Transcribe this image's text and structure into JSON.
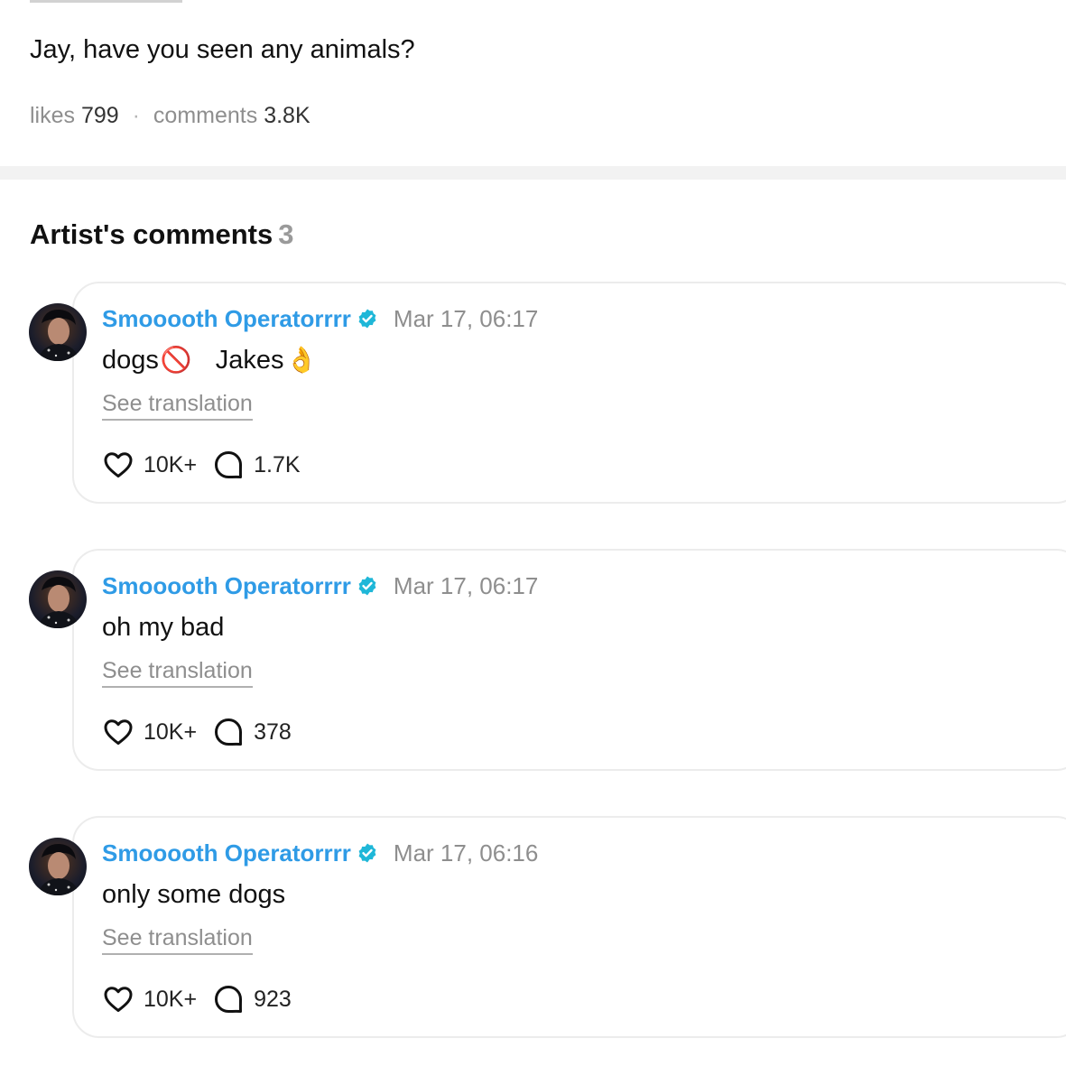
{
  "post": {
    "text": "Jay, have you seen any animals?",
    "likes_label": "likes",
    "likes_count": "799",
    "separator": "·",
    "comments_label": "comments",
    "comments_count": "3.8K"
  },
  "section": {
    "title": "Artist's comments",
    "count": "3"
  },
  "comments": [
    {
      "author": "Smooooth Operatorrrr",
      "time": "Mar 17, 06:17",
      "text_a": "dogs",
      "emoji_a": "🚫",
      "text_b": "Jakes",
      "emoji_b": "👌",
      "translate": "See translation",
      "likes": "10K+",
      "replies": "1.7K"
    },
    {
      "author": "Smooooth Operatorrrr",
      "time": "Mar 17, 06:17",
      "text": "oh my bad",
      "translate": "See translation",
      "likes": "10K+",
      "replies": "378"
    },
    {
      "author": "Smooooth Operatorrrr",
      "time": "Mar 17, 06:16",
      "text": "only some dogs",
      "translate": "See translation",
      "likes": "10K+",
      "replies": "923"
    }
  ],
  "icons": {
    "verified": "verified-badge-icon",
    "like": "heart-icon",
    "reply": "speech-bubble-icon"
  },
  "colors": {
    "author": "#2f9be6",
    "verified": "#1fb7d8",
    "muted": "#8e8e8e"
  }
}
